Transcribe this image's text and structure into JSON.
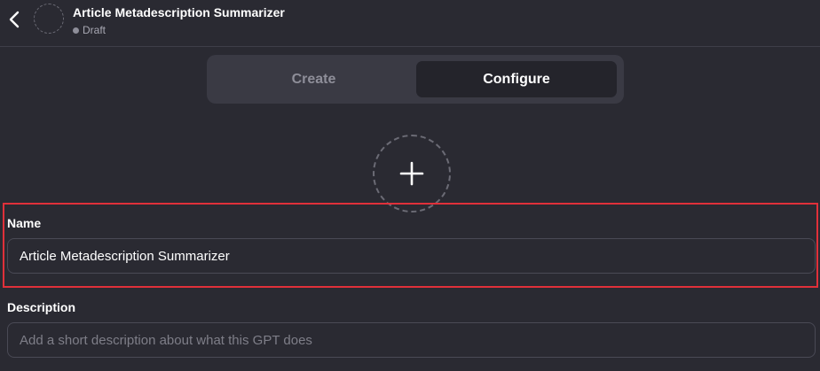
{
  "header": {
    "title": "Article Metadescription Summarizer",
    "status": "Draft",
    "back_icon": "chevron-left-icon",
    "avatar_icon": "empty-avatar-icon"
  },
  "tabs": [
    {
      "label": "Create",
      "active": false
    },
    {
      "label": "Configure",
      "active": true
    }
  ],
  "avatar_upload": {
    "icon": "plus-icon"
  },
  "form": {
    "name": {
      "label": "Name",
      "value": "Article Metadescription Summarizer"
    },
    "description": {
      "label": "Description",
      "value": "",
      "placeholder": "Add a short description about what this GPT does"
    }
  },
  "colors": {
    "background": "#2a2a32",
    "tab_bar": "#3a3a44",
    "active_tab": "#24242b",
    "highlight": "#e0303a",
    "text": "#ffffff",
    "muted_text": "#8e8e99"
  }
}
